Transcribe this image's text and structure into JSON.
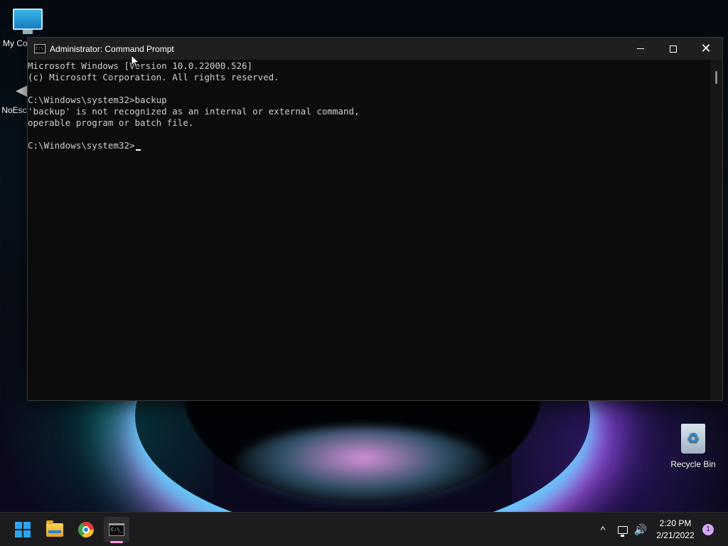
{
  "desktop": {
    "icons": {
      "my_computer": "My Computer",
      "noescape": "NoEscape",
      "recycle_bin": "Recycle Bin"
    }
  },
  "window": {
    "title": "Administrator: Command Prompt",
    "console_lines": [
      "Microsoft Windows [Version 10.0.22000.526]",
      "(c) Microsoft Corporation. All rights reserved.",
      "",
      "C:\\Windows\\system32>backup",
      "'backup' is not recognized as an internal or external command,",
      "operable program or batch file.",
      "",
      "C:\\Windows\\system32>"
    ],
    "text_color": "#cccccc",
    "background_color": "#0c0c0c"
  },
  "taskbar": {
    "apps": [
      "start",
      "file-explorer",
      "chrome",
      "command-prompt"
    ],
    "active_app": "command-prompt",
    "accent": "#ff9adf"
  },
  "tray": {
    "chevron": "^",
    "time": "2:20 PM",
    "date": "2/21/2022",
    "notification_count": "1"
  }
}
